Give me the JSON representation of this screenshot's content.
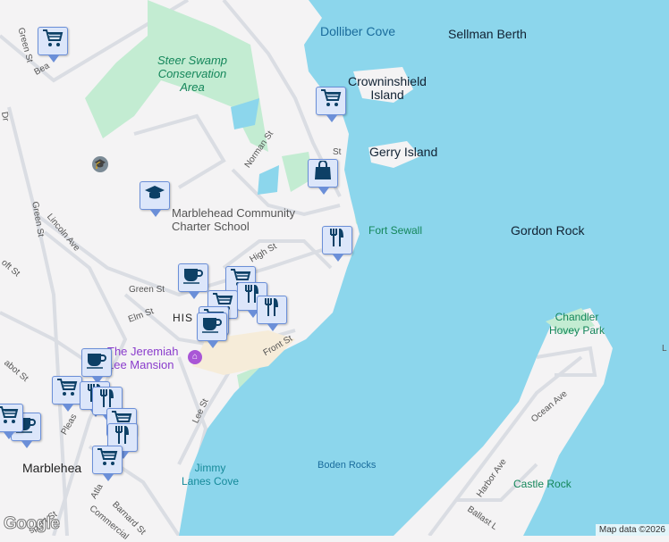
{
  "colors": {
    "water": "#8cd6ec",
    "land": "#f4f3f4",
    "park": "#c3ecd2",
    "road": "#dadde3",
    "marker_bg": "#dce6fa",
    "marker_border": "#6b8fd8",
    "icon": "#0d4066"
  },
  "water_labels": {
    "dolliber": "Dolliber Cove",
    "sellman": "Sellman Berth",
    "crowninshield": "Crowninshield Island",
    "gerry": "Gerry Island",
    "gordon": "Gordon Rock",
    "boden": "Boden Rocks",
    "jimmy": "Jimmy Lanes Cove"
  },
  "park_labels": {
    "steer": "Steer Swamp Conservation Area",
    "fort": "Fort Sewall",
    "chandler": "Chandler Hovey Park",
    "castle": "Castle Rock"
  },
  "places": {
    "school": "Marblehead Community Charter School",
    "mansion": "The Jeremiah Lee Mansion",
    "town": "Marblehea",
    "historic": "HIS    NT",
    "historic_m": "M"
  },
  "streets": {
    "green1": "Green St",
    "green2": "Green St",
    "green3": "Green St",
    "norman": "Norman St",
    "high": "High St",
    "lincoln": "Lincoln Ave",
    "elm": "Elm St",
    "front": "Front St",
    "lee": "Lee St",
    "ocean": "Ocean Ave",
    "harbor": "Harbor Ave",
    "ballast": "Ballast L",
    "barnard": "Barnard St",
    "commercial": "Commercial",
    "atlantic": "Atla",
    "prospect": "spect St",
    "pleasant": "Pleas",
    "abbot": "abot St",
    "beacon": "Bea",
    "croft": "oft St",
    "dr": "Dr",
    "st_top": "St",
    "l_edge": "L"
  },
  "attribution": "Map data ©2026",
  "logo": "Google",
  "markers": [
    {
      "type": "cart"
    },
    {
      "type": "cart"
    },
    {
      "type": "bag"
    },
    {
      "type": "school"
    },
    {
      "type": "food"
    },
    {
      "type": "coffee"
    },
    {
      "type": "cart"
    },
    {
      "type": "cart"
    },
    {
      "type": "food"
    },
    {
      "type": "cart"
    },
    {
      "type": "food"
    },
    {
      "type": "coffee"
    },
    {
      "type": "coffee"
    },
    {
      "type": "cart"
    },
    {
      "type": "food"
    },
    {
      "type": "food"
    },
    {
      "type": "cart"
    },
    {
      "type": "food"
    },
    {
      "type": "cart"
    },
    {
      "type": "coffee"
    },
    {
      "type": "cart"
    }
  ]
}
